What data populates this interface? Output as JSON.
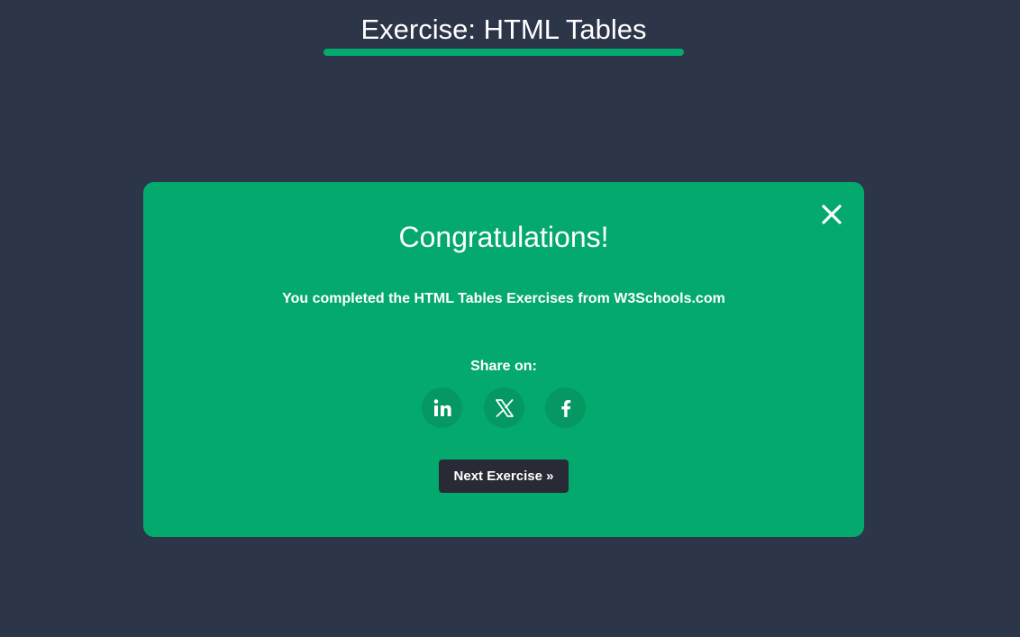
{
  "header": {
    "title": "Exercise: HTML Tables"
  },
  "modal": {
    "close_icon": "close-icon",
    "heading": "Congratulations!",
    "message": "You completed the HTML Tables Exercises from W3Schools.com",
    "share_label": "Share on:",
    "share_buttons": [
      {
        "icon": "linkedin-icon"
      },
      {
        "icon": "x-icon"
      },
      {
        "icon": "facebook-icon"
      }
    ],
    "next_label": "Next Exercise »"
  },
  "colors": {
    "page_background": "#2d3548",
    "accent_green": "#04aa6d",
    "share_button_bg": "#059862",
    "next_button_bg": "#282a35",
    "text": "#ffffff"
  }
}
